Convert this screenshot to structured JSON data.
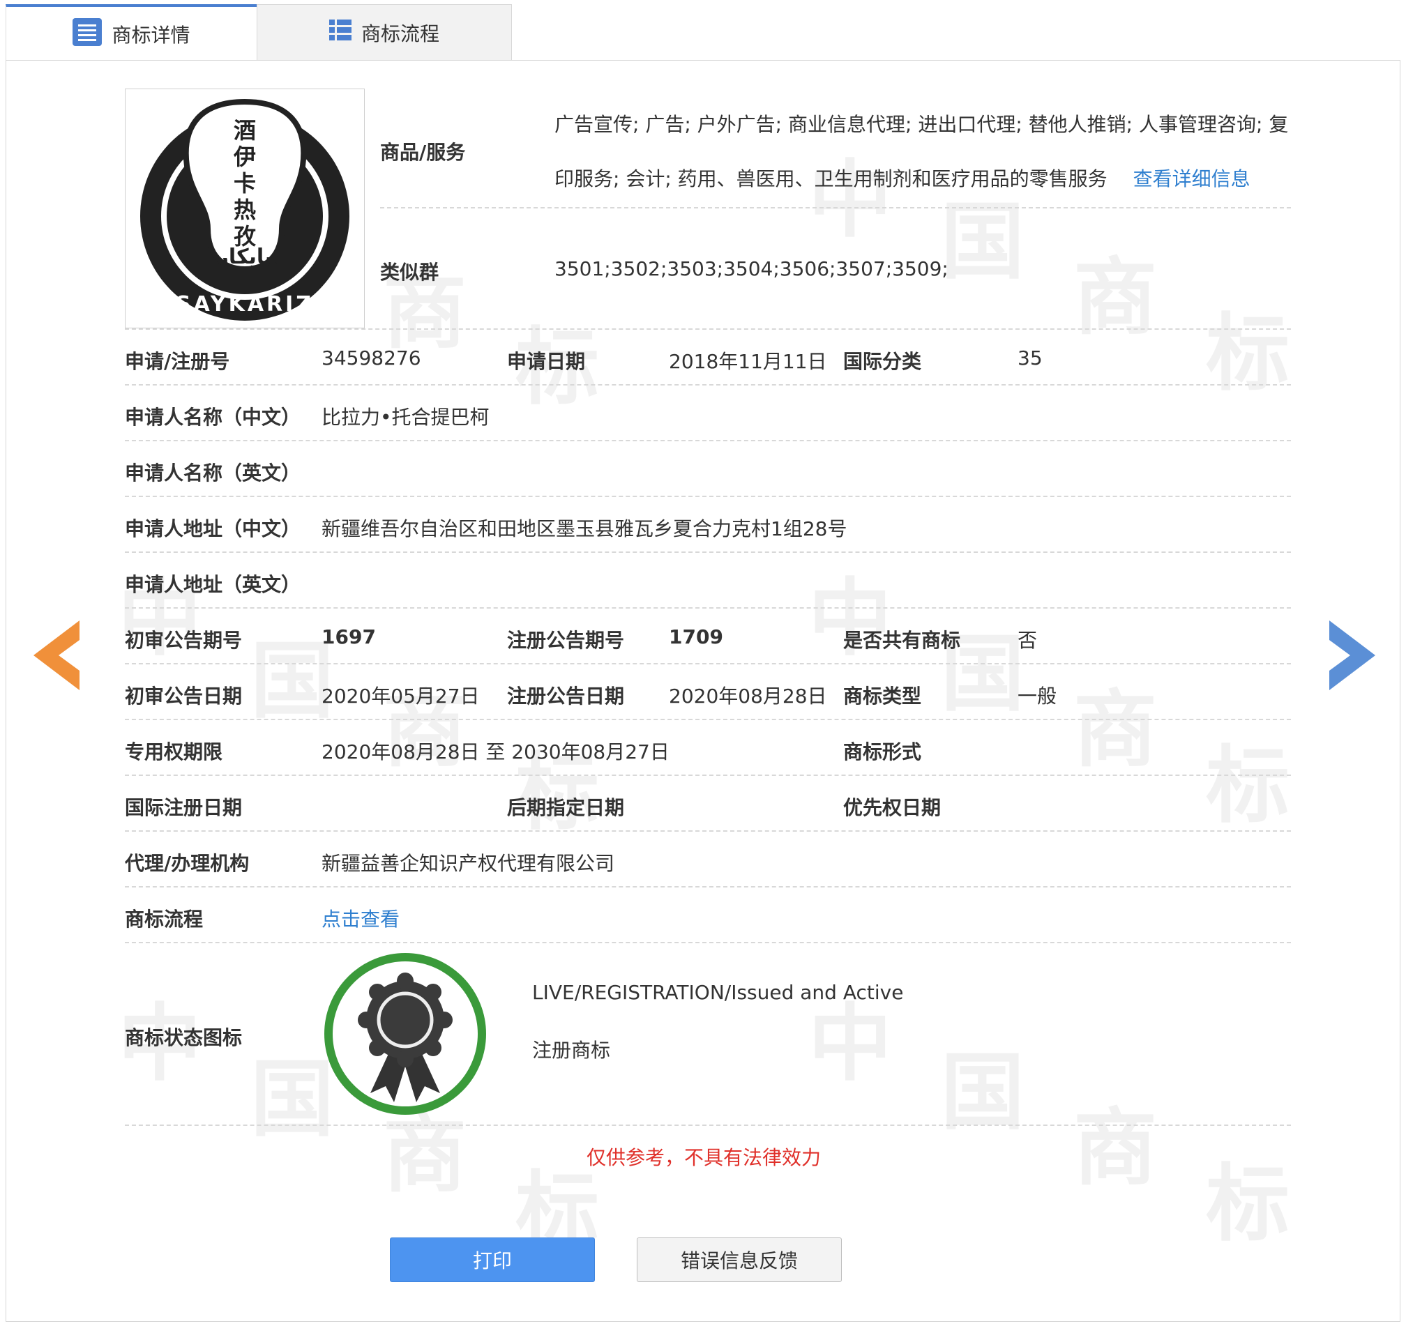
{
  "tabs": [
    {
      "label": "商标详情",
      "icon": "list-icon",
      "active": true
    },
    {
      "label": "商标流程",
      "icon": "grid-list-icon",
      "active": false
    }
  ],
  "logo": {
    "top_text": "酒伊卡热孜",
    "bottom_text": "SAYKARIZ",
    "arabic_text": "سايكارز"
  },
  "goods": {
    "label": "商品/服务",
    "line1": "广告宣传; 广告; 户外广告; 商业信息代理; 进出口代理; 替他人推销; 人事管理咨询; 复",
    "line2": "印服务; 会计; 药用、兽医用、卫生用制剂和医疗用品的零售服务",
    "detail_link": "查看详细信息"
  },
  "similar": {
    "label": "类似群",
    "value": "3501;3502;3503;3504;3506;3507;3509;"
  },
  "app_no": {
    "label": "申请/注册号",
    "value": "34598276"
  },
  "app_date": {
    "label": "申请日期",
    "value": "2018年11月11日"
  },
  "intl_class": {
    "label": "国际分类",
    "value": "35"
  },
  "applicant_cn": {
    "label": "申请人名称（中文）",
    "value": "比拉力•托合提巴柯"
  },
  "applicant_en": {
    "label": "申请人名称（英文）",
    "value": ""
  },
  "address_cn": {
    "label": "申请人地址（中文）",
    "value": "新疆维吾尔自治区和田地区墨玉县雅瓦乡夏合力克村1组28号"
  },
  "address_en": {
    "label": "申请人地址（英文）",
    "value": ""
  },
  "prelim_issue": {
    "label": "初审公告期号",
    "value": "1697"
  },
  "reg_issue": {
    "label": "注册公告期号",
    "value": "1709"
  },
  "shared": {
    "label": "是否共有商标",
    "value": "否"
  },
  "prelim_date": {
    "label": "初审公告日期",
    "value": "2020年05月27日"
  },
  "reg_date": {
    "label": "注册公告日期",
    "value": "2020年08月28日"
  },
  "tm_type": {
    "label": "商标类型",
    "value": "一般"
  },
  "exclusive_period": {
    "label": "专用权期限",
    "value": "2020年08月28日 至 2030年08月27日"
  },
  "tm_form": {
    "label": "商标形式",
    "value": ""
  },
  "intl_reg_date": {
    "label": "国际注册日期",
    "value": ""
  },
  "later_date": {
    "label": "后期指定日期",
    "value": ""
  },
  "priority_date": {
    "label": "优先权日期",
    "value": ""
  },
  "agency": {
    "label": "代理/办理机构",
    "value": "新疆益善企知识产权代理有限公司"
  },
  "process": {
    "label": "商标流程",
    "link": "点击查看"
  },
  "status": {
    "label": "商标状态图标",
    "en": "LIVE/REGISTRATION/Issued and Active",
    "cn": "注册商标",
    "icon": "award-badge-icon"
  },
  "disclaimer": "仅供参考，不具有法律效力",
  "buttons": {
    "print": "打印",
    "feedback": "错误信息反馈"
  },
  "watermark_text": [
    "中",
    "国",
    "商",
    "标"
  ],
  "nav": {
    "prev_icon": "prev-arrow-icon",
    "next_icon": "next-arrow-icon"
  },
  "colors": {
    "accent": "#4a7fd0",
    "link": "#2f7fcf",
    "warning": "#e0302a",
    "prev_arrow": "#f0903a",
    "next_arrow": "#5b8fd6",
    "status_ring": "#3a9a3a"
  }
}
